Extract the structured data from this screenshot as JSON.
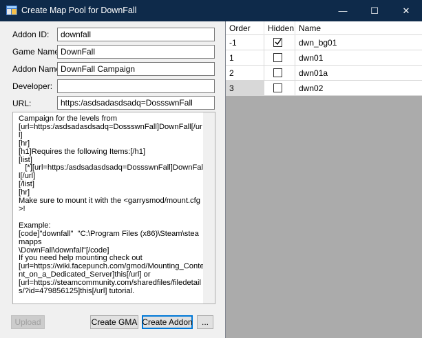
{
  "window": {
    "title": "Create Map Pool for DownFall",
    "minimize_glyph": "—",
    "maximize_glyph": "☐",
    "close_glyph": "✕"
  },
  "form": {
    "addon_id": {
      "label": "Addon ID:",
      "value": "downfall"
    },
    "game_name": {
      "label": "Game Name:",
      "value": "DownFall"
    },
    "addon_name": {
      "label": "Addon Name:",
      "value": "DownFall Campaign"
    },
    "developer": {
      "label": "Developer:",
      "value": ""
    },
    "url": {
      "label": "URL:",
      "value": "https:/asdsadasdsadq=DossswnFall"
    }
  },
  "description": "Campaign for the levels from\n[url=https:/asdsadasdsadq=DossswnFall]DownFall[/url]\n[hr]\n[h1]Requires the following Items:[/h1]\n[list]\n   [*][url=https:/asdsadasdsadq=DossswnFall]DownFall[/url]\n[/list]\n[hr]\nMake sure to mount it with the <garrysmod/mount.cfg>!\n\nExample:\n[code]\"downfall\"  \"C:\\Program Files (x86)\\Steam\\steamapps\n\\DownFall\\downfall\"[/code]\nIf you need help mounting check out\n[url=https://wiki.facepunch.com/gmod/Mounting_Content_on_a_Dedicated_Server]this[/url] or\n[url=https://steamcommunity.com/sharedfiles/filedetails/?id=479856125]this[/url] tutorial.\n\n[hr]\n\nThis map pool was created with the help of\n[url=https://github.com/Pluorgam/GMod-Mount",
  "buttons": {
    "upload": "Upload",
    "create_gma": "Create GMA",
    "create_addon": "Create Addon",
    "more": "..."
  },
  "grid": {
    "columns": [
      "Order",
      "Hidden",
      "Name"
    ],
    "rows": [
      {
        "order": "-1",
        "hidden": true,
        "name": "dwn_bg01"
      },
      {
        "order": "1",
        "hidden": false,
        "name": "dwn01"
      },
      {
        "order": "2",
        "hidden": false,
        "name": "dwn01a"
      },
      {
        "order": "3",
        "hidden": false,
        "name": "dwn02"
      }
    ]
  },
  "colors": {
    "titlebar": "#0e2a4a",
    "grid_background": "#ababab",
    "focus_border": "#0078d7"
  }
}
